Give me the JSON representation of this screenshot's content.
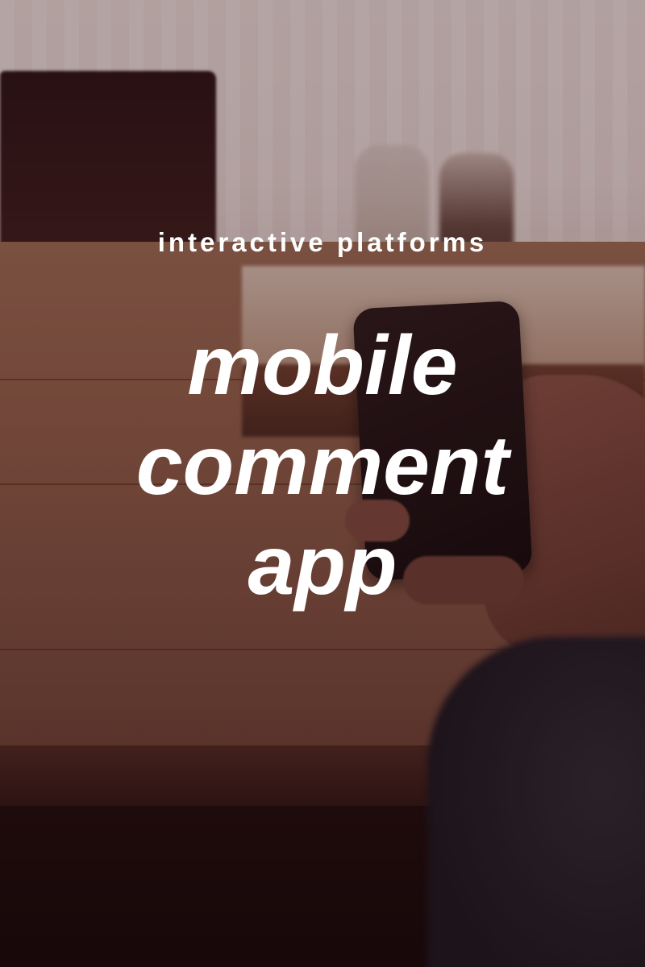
{
  "kicker": "interactive platforms",
  "headline": {
    "line1": "mobile",
    "line2": "comment",
    "line3": "app"
  }
}
